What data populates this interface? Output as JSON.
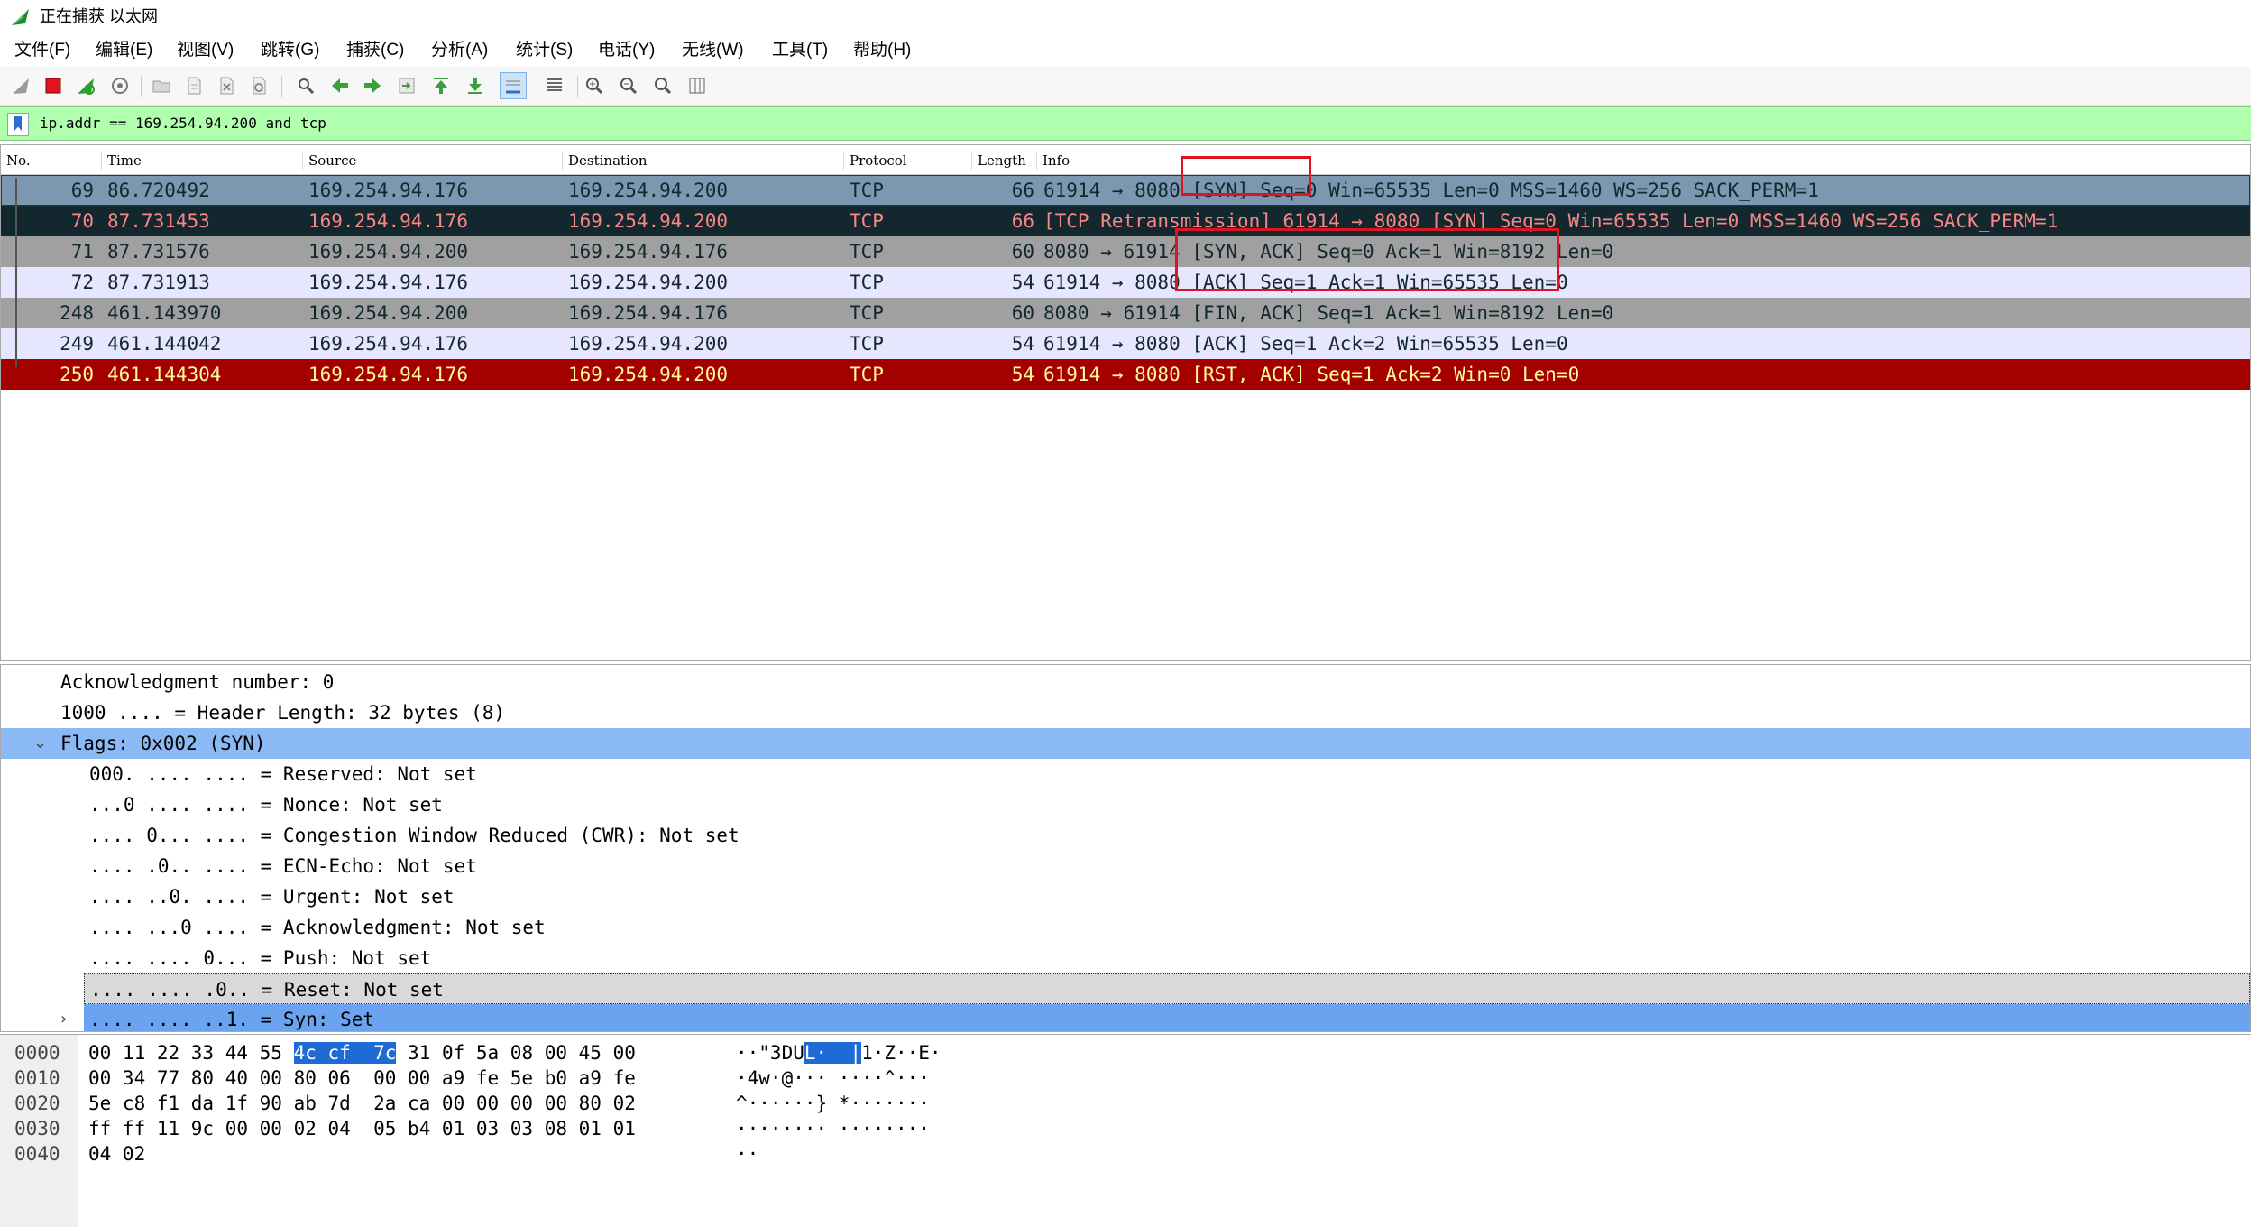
{
  "window": {
    "title": "正在捕获 以太网"
  },
  "menu": [
    {
      "label": "文件(F)"
    },
    {
      "label": "编辑(E)"
    },
    {
      "label": "视图(V)"
    },
    {
      "label": "跳转(G)"
    },
    {
      "label": "捕获(C)"
    },
    {
      "label": "分析(A)"
    },
    {
      "label": "统计(S)"
    },
    {
      "label": "电话(Y)"
    },
    {
      "label": "无线(W)"
    },
    {
      "label": "工具(T)"
    },
    {
      "label": "帮助(H)"
    }
  ],
  "toolbar": {
    "icons": [
      "shark-fin-start-icon",
      "stop-square-icon",
      "restart-capture-icon",
      "capture-options-icon",
      "open-folder-icon",
      "save-file-icon",
      "close-file-icon",
      "reload-file-icon",
      "find-packet-icon",
      "go-back-icon",
      "go-forward-icon",
      "go-to-packet-icon",
      "go-first-icon",
      "go-last-icon",
      "auto-scroll-icon",
      "colorize-icon",
      "zoom-in-icon",
      "zoom-out-icon",
      "zoom-reset-icon",
      "resize-columns-icon"
    ],
    "colors": {
      "start": "#9a9a9a",
      "stop": "#e0141e",
      "restart": "#2aa12a",
      "arrow_green": "#3ba03b",
      "accent": "#2b6fd0"
    }
  },
  "filter": {
    "value": "ip.addr == 169.254.94.200 and tcp"
  },
  "packet_list": {
    "columns": [
      "No.",
      "Time",
      "Source",
      "Destination",
      "Protocol",
      "Length",
      "Info"
    ],
    "rows": [
      {
        "no": "69",
        "time": "86.720492",
        "src": "169.254.94.176",
        "dst": "169.254.94.200",
        "proto": "TCP",
        "len": "66",
        "info": "61914 → 8080 [SYN] Seq=0 Win=65535 Len=0 MSS=1460 WS=256 SACK_PERM=1",
        "bg": "#7c97b0",
        "fg": "#12272e"
      },
      {
        "no": "70",
        "time": "87.731453",
        "src": "169.254.94.176",
        "dst": "169.254.94.200",
        "proto": "TCP",
        "len": "66",
        "info": "[TCP Retransmission] 61914 → 8080 [SYN] Seq=0 Win=65535 Len=0 MSS=1460 WS=256 SACK_PERM=1",
        "bg": "#12272e",
        "fg": "#f78787"
      },
      {
        "no": "71",
        "time": "87.731576",
        "src": "169.254.94.200",
        "dst": "169.254.94.176",
        "proto": "TCP",
        "len": "60",
        "info": "8080 → 61914 [SYN, ACK] Seq=0 Ack=1 Win=8192 Len=0",
        "bg": "#a0a0a0",
        "fg": "#12272e"
      },
      {
        "no": "72",
        "time": "87.731913",
        "src": "169.254.94.176",
        "dst": "169.254.94.200",
        "proto": "TCP",
        "len": "54",
        "info": "61914 → 8080 [ACK] Seq=1 Ack=1 Win=65535 Len=0",
        "bg": "#e7e6ff",
        "fg": "#12272e"
      },
      {
        "no": "248",
        "time": "461.143970",
        "src": "169.254.94.200",
        "dst": "169.254.94.176",
        "proto": "TCP",
        "len": "60",
        "info": "8080 → 61914 [FIN, ACK] Seq=1 Ack=1 Win=8192 Len=0",
        "bg": "#a0a0a0",
        "fg": "#12272e"
      },
      {
        "no": "249",
        "time": "461.144042",
        "src": "169.254.94.176",
        "dst": "169.254.94.200",
        "proto": "TCP",
        "len": "54",
        "info": "61914 → 8080 [ACK] Seq=1 Ack=2 Win=65535 Len=0",
        "bg": "#e7e6ff",
        "fg": "#12272e"
      },
      {
        "no": "250",
        "time": "461.144304",
        "src": "169.254.94.176",
        "dst": "169.254.94.200",
        "proto": "TCP",
        "len": "54",
        "info": "61914 → 8080 [RST, ACK] Seq=1 Ack=2 Win=0 Len=0",
        "bg": "#a40000",
        "fg": "#fffc9c"
      }
    ]
  },
  "details": {
    "lines": [
      {
        "text": "Acknowledgment number: 0",
        "style": "normal"
      },
      {
        "text": "1000 .... = Header Length: 32 bytes (8)",
        "style": "normal"
      },
      {
        "text": "Flags: 0x002 (SYN)",
        "style": "sel",
        "expander": "⌄"
      },
      {
        "text": "000. .... .... = Reserved: Not set",
        "style": "normal"
      },
      {
        "text": "...0 .... .... = Nonce: Not set",
        "style": "normal"
      },
      {
        "text": ".... 0... .... = Congestion Window Reduced (CWR): Not set",
        "style": "normal"
      },
      {
        "text": ".... .0.. .... = ECN-Echo: Not set",
        "style": "normal"
      },
      {
        "text": ".... ..0. .... = Urgent: Not set",
        "style": "normal"
      },
      {
        "text": ".... ...0 .... = Acknowledgment: Not set",
        "style": "normal"
      },
      {
        "text": ".... .... 0... = Push: Not set",
        "style": "normal"
      },
      {
        "text": ".... .... .0.. = Reset: Not set",
        "style": "hov"
      },
      {
        "text": ".... .... ..1. = Syn: Set",
        "style": "sel2",
        "expander": "›"
      }
    ]
  },
  "bytes": {
    "rows": [
      {
        "off": "0000",
        "hex_a": "00 11 22 33 44 55 ",
        "hex_hl": "4c cf  7c",
        "hex_b": " 31 0f 5a 08 00 45 00",
        "asc_a": "··\"3DU",
        "asc_hl": "L·  |",
        "asc_b": "1·Z··E·"
      },
      {
        "off": "0010",
        "hex_a": "00 34 77 80 40 00 80 06  00 00 a9 fe 5e b0 a9 fe",
        "hex_hl": "",
        "hex_b": "",
        "asc_a": "·4w·@··· ····^···",
        "asc_hl": "",
        "asc_b": ""
      },
      {
        "off": "0020",
        "hex_a": "5e c8 f1 da 1f 90 ab 7d  2a ca 00 00 00 00 80 02",
        "hex_hl": "",
        "hex_b": "",
        "asc_a": "^······} *·······",
        "asc_hl": "",
        "asc_b": ""
      },
      {
        "off": "0030",
        "hex_a": "ff ff 11 9c 00 00 02 04  05 b4 01 03 03 08 01 01",
        "hex_hl": "",
        "hex_b": "",
        "asc_a": "········ ········",
        "asc_hl": "",
        "asc_b": ""
      },
      {
        "off": "0040",
        "hex_a": "04 02",
        "hex_hl": "",
        "hex_b": "",
        "asc_a": "··",
        "asc_hl": "",
        "asc_b": ""
      }
    ]
  }
}
